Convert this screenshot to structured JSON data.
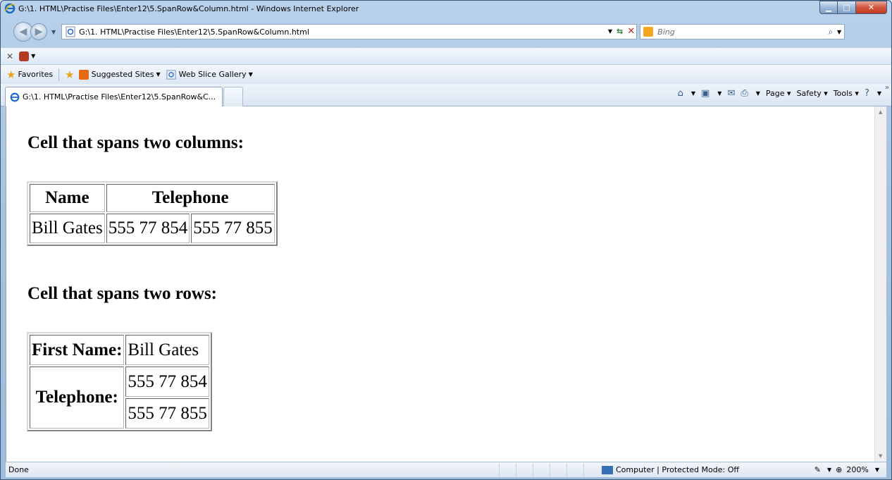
{
  "window": {
    "title": "G:\\1. HTML\\Practise Files\\Enter12\\5.SpanRow&Column.html - Windows Internet Explorer"
  },
  "address_bar": {
    "url": "G:\\1. HTML\\Practise Files\\Enter12\\5.SpanRow&Column.html"
  },
  "search": {
    "placeholder": "Bing"
  },
  "favorites_bar": {
    "favorites_label": "Favorites",
    "items": [
      "Suggested Sites",
      "Web Slice Gallery"
    ]
  },
  "tabs": [
    {
      "label": "G:\\1. HTML\\Practise Files\\Enter12\\5.SpanRow&C..."
    }
  ],
  "command_bar": {
    "page_label": "Page",
    "safety_label": "Safety",
    "tools_label": "Tools"
  },
  "content": {
    "heading1": "Cell that spans two columns:",
    "table1": {
      "headers": [
        "Name",
        "Telephone"
      ],
      "row": [
        "Bill Gates",
        "555 77 854",
        "555 77 855"
      ]
    },
    "heading2": "Cell that spans two rows:",
    "table2": {
      "first_name_label": "First Name:",
      "first_name_value": "Bill Gates",
      "telephone_label": "Telephone:",
      "telephone_values": [
        "555 77 854",
        "555 77 855"
      ]
    }
  },
  "status_bar": {
    "left": "Done",
    "zone": "Computer | Protected Mode: Off",
    "zoom": "200%"
  }
}
